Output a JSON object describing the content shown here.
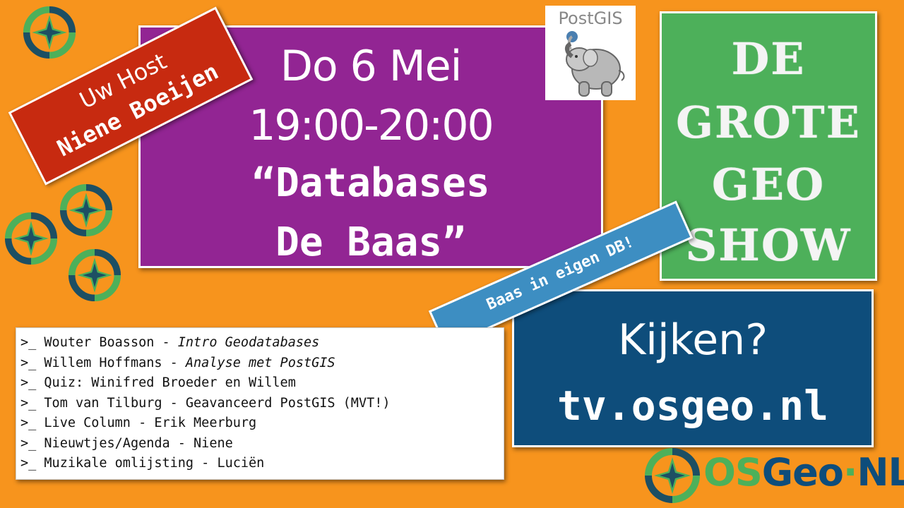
{
  "event": {
    "date": "Do 6 Mei",
    "time": "19:00-20:00",
    "title_line_1": "“Databases",
    "title_line_2": "De Baas”"
  },
  "host": {
    "line_1": "Uw Host",
    "line_2": "Niene Boeijen"
  },
  "postgis_logo": {
    "text": "PostGIS"
  },
  "show_title": {
    "words": [
      "DE",
      "GROTE",
      "GEO",
      "SHOW"
    ]
  },
  "tag": {
    "text": "Baas in eigen DB!"
  },
  "watch": {
    "question": "Kijken?",
    "url": "tv.osgeo.nl"
  },
  "program": [
    {
      "prompt": ">_",
      "text": "Wouter Boasson - ",
      "emphasis": "Intro Geodatabases"
    },
    {
      "prompt": ">_",
      "text": "Willem Hoffmans - ",
      "emphasis": "Analyse met PostGIS"
    },
    {
      "prompt": ">_",
      "text": "Quiz: Winifred Broeder en Willem",
      "emphasis": ""
    },
    {
      "prompt": ">_",
      "text": "Tom van Tilburg - Geavanceerd PostGIS (MVT!)",
      "emphasis": ""
    },
    {
      "prompt": ">_",
      "text": "Live Column - Erik Meerburg",
      "emphasis": ""
    },
    {
      "prompt": ">_",
      "text": "Nieuwtjes/Agenda - Niene",
      "emphasis": ""
    },
    {
      "prompt": ">_",
      "text": "Muzikale omlijsting - Luciën",
      "emphasis": ""
    }
  ],
  "osgeo_logo": {
    "os": "OS",
    "geo": "Geo",
    "dot": "·",
    "nl": "NL"
  },
  "colors": {
    "background": "#f7941d",
    "event_panel": "#922593",
    "host_banner": "#c72a10",
    "show_panel": "#4db05a",
    "watch_panel": "#0e4d7b",
    "tag_banner": "#3d8ec2"
  },
  "icons": [
    "compass-icon",
    "postgis-elephant-icon",
    "osgeo-compass-icon"
  ]
}
